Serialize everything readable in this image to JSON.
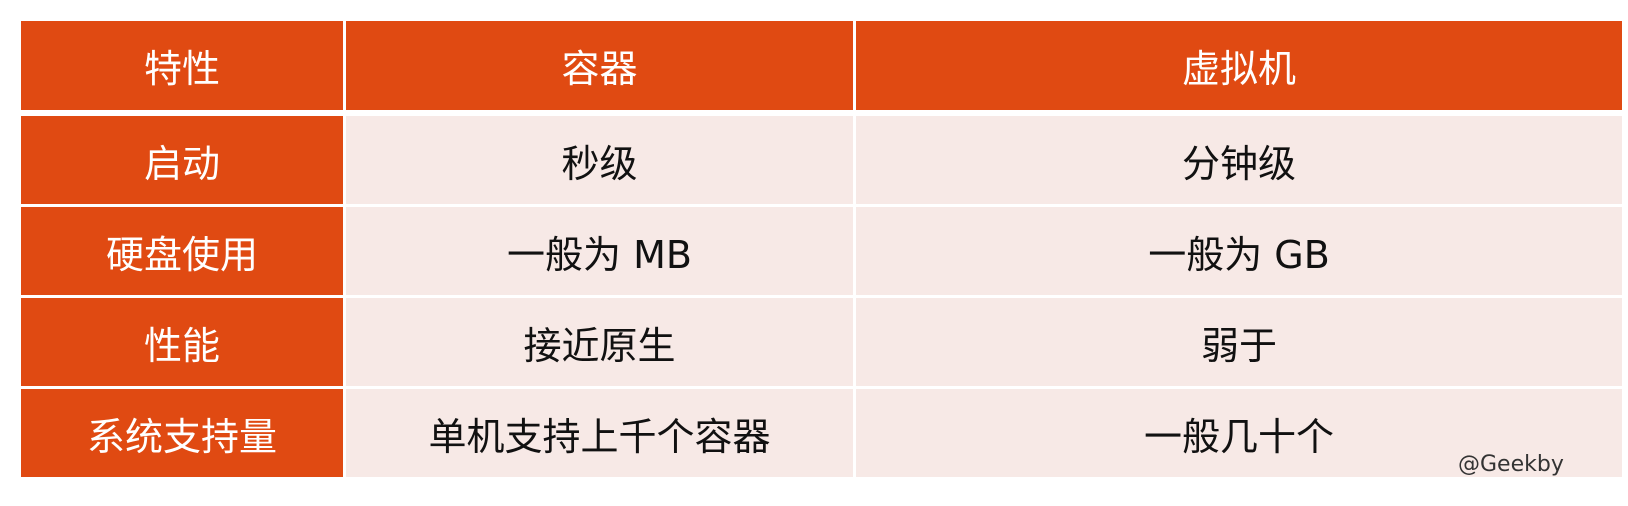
{
  "table": {
    "headers": [
      "特性",
      "容器",
      "虚拟机"
    ],
    "rows": [
      {
        "feature": "启动",
        "container": "秒级",
        "vm": "分钟级"
      },
      {
        "feature": "硬盘使用",
        "container": "一般为 MB",
        "vm": "一般为 GB"
      },
      {
        "feature": "性能",
        "container": "接近原生",
        "vm": "弱于"
      },
      {
        "feature": "系统支持量",
        "container": "单机支持上千个容器",
        "vm": "一般几十个"
      }
    ]
  },
  "watermark": "@Geekby",
  "colors": {
    "header_bg": "#e04a12",
    "cell_bg": "#f7e9e6",
    "header_text": "#ffffff",
    "cell_text": "#111111"
  }
}
